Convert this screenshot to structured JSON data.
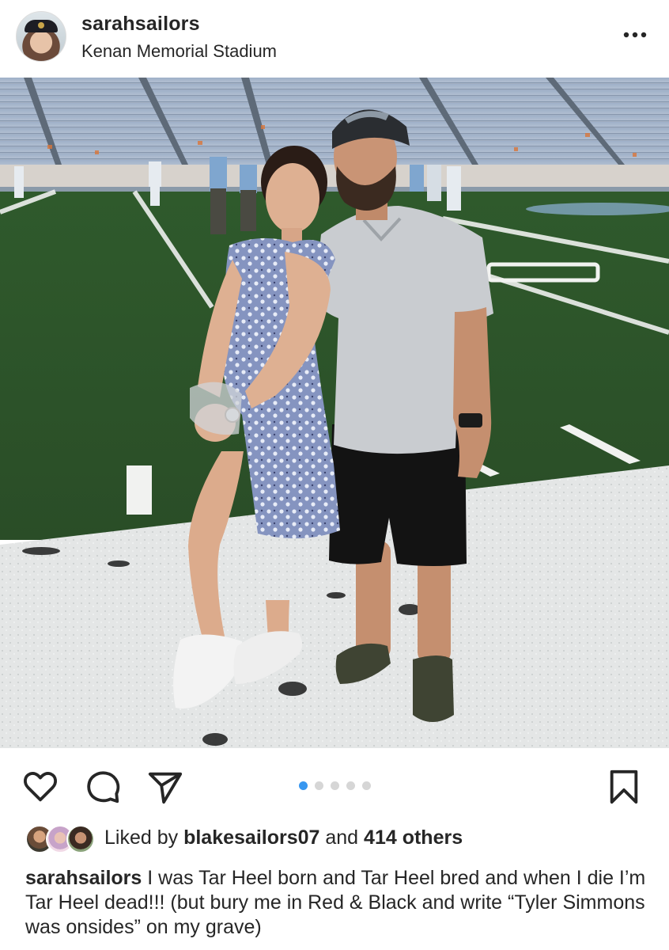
{
  "header": {
    "username": "sarahsailors",
    "location": "Kenan Memorial Stadium",
    "avatar_icon": "profile-avatar",
    "more_icon": "more-horizontal-icon"
  },
  "photo": {
    "carousel_count": 5,
    "carousel_active": 1
  },
  "actions": {
    "like_icon": "heart-icon",
    "comment_icon": "comment-icon",
    "share_icon": "paper-plane-icon",
    "save_icon": "bookmark-icon",
    "accent_color": "#3897f0"
  },
  "likes": {
    "prefix": "Liked by",
    "top_liker": "blakesailors07",
    "connector": "and",
    "others": "414 others"
  },
  "caption": {
    "username": "sarahsailors",
    "text": "I was Tar Heel born and Tar Heel bred and when I die I’m Tar Heel dead!!! (but bury me in Red & Black and write “Tyler Simmons was onsides” on my grave)"
  }
}
